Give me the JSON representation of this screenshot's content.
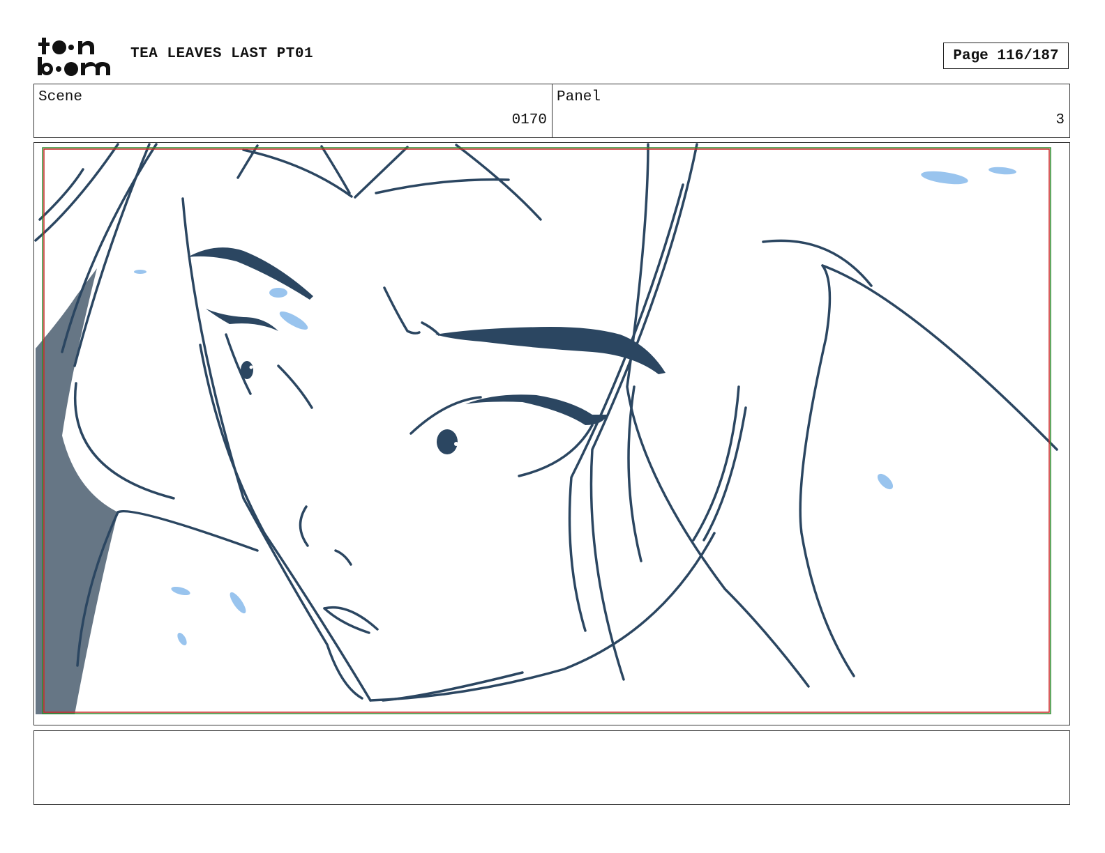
{
  "header": {
    "logo_text": "toon boom",
    "project_title": "TEA LEAVES LAST PT01",
    "page_label": "Page 116/187"
  },
  "info": {
    "scene_label": "Scene",
    "scene_value": "0170",
    "panel_label": "Panel",
    "panel_value": "3"
  },
  "artwork": {
    "line_color": "#2b4661",
    "highlight_color": "#99c4ee",
    "shadow_color": "#667685",
    "safe_frame_colors": [
      "#cc2a2a",
      "#2e8b2e"
    ]
  },
  "notes": {
    "text": ""
  }
}
